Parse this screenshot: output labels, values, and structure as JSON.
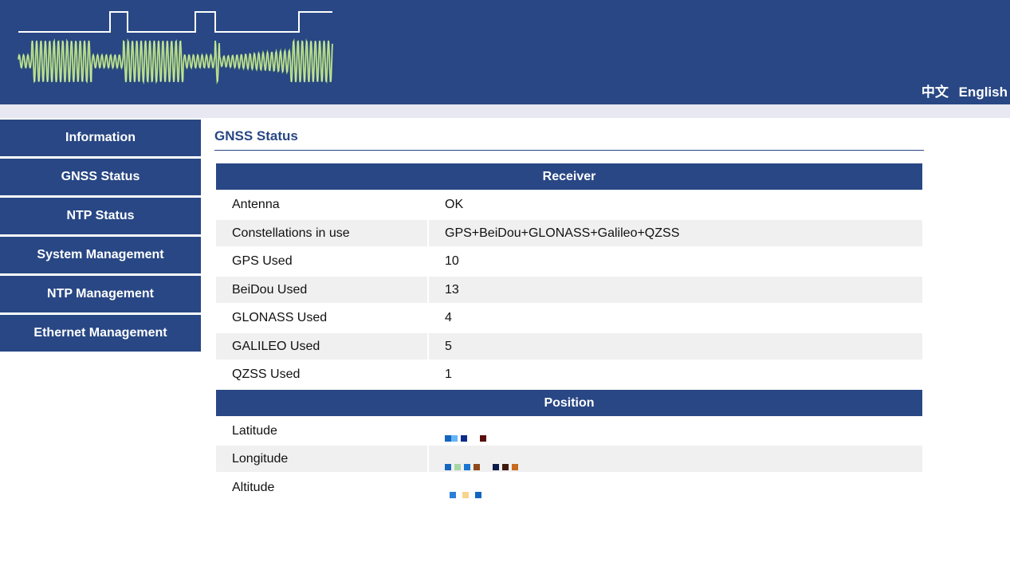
{
  "header": {
    "lang_zh": "中文",
    "lang_en": "English"
  },
  "nav": {
    "items": [
      {
        "label": "Information"
      },
      {
        "label": "GNSS Status"
      },
      {
        "label": "NTP Status"
      },
      {
        "label": "System Management"
      },
      {
        "label": "NTP Management"
      },
      {
        "label": "Ethernet Management"
      }
    ]
  },
  "main": {
    "title": "GNSS Status",
    "receiver": {
      "heading": "Receiver",
      "rows": [
        {
          "label": "Antenna",
          "value": "OK"
        },
        {
          "label": "Constellations in use",
          "value": "GPS+BeiDou+GLONASS+Galileo+QZSS"
        },
        {
          "label": "GPS Used",
          "value": "10"
        },
        {
          "label": "BeiDou Used",
          "value": "13"
        },
        {
          "label": "GLONASS Used",
          "value": "4"
        },
        {
          "label": "GALILEO Used",
          "value": "5"
        },
        {
          "label": "QZSS Used",
          "value": "1"
        }
      ]
    },
    "position": {
      "heading": "Position",
      "rows": [
        {
          "label": "Latitude",
          "value": ""
        },
        {
          "label": "Longitude",
          "value": ""
        },
        {
          "label": "Altitude",
          "value": ""
        }
      ]
    }
  },
  "colors": {
    "primary": "#284784",
    "row_alt": "#f0f0f0",
    "subbar": "#e8e8f3",
    "wave": "#9ccc65"
  }
}
